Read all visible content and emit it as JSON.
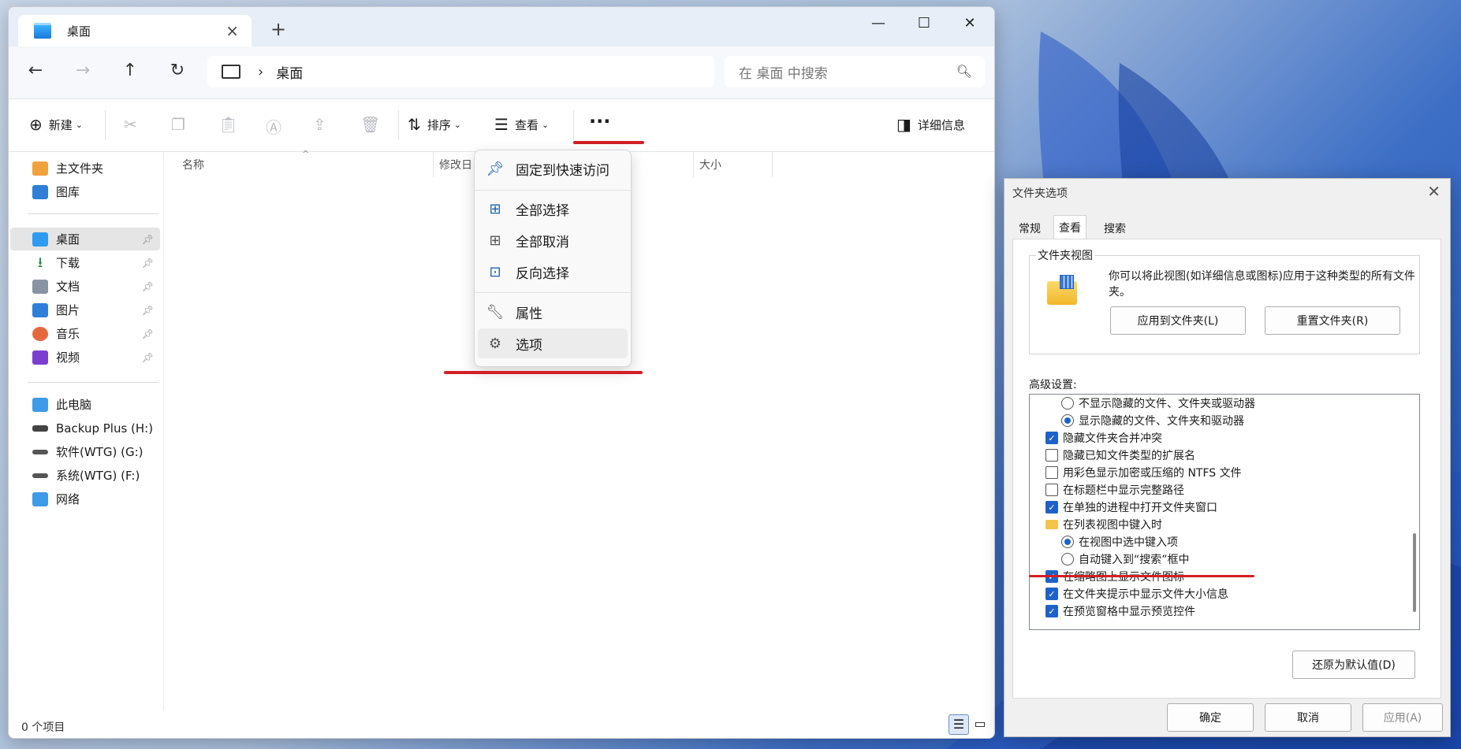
{
  "explorer": {
    "tab_title": "桌面",
    "address_path": "桌面",
    "search_placeholder": "在 桌面 中搜索",
    "toolbar": {
      "new_label": "新建",
      "sort_label": "排序",
      "view_label": "查看",
      "details_label": "详细信息"
    },
    "sidebar": {
      "top": [
        {
          "label": "主文件夹"
        },
        {
          "label": "图库"
        }
      ],
      "pinned": [
        {
          "label": "桌面",
          "selected": true
        },
        {
          "label": "下载"
        },
        {
          "label": "文档"
        },
        {
          "label": "图片"
        },
        {
          "label": "音乐"
        },
        {
          "label": "视频"
        }
      ],
      "drives": [
        {
          "label": "此电脑"
        },
        {
          "label": "Backup Plus (H:)"
        },
        {
          "label": "软件(WTG) (G:)"
        },
        {
          "label": "系统(WTG) (F:)"
        },
        {
          "label": "网络"
        }
      ]
    },
    "columns": {
      "name": "名称",
      "modified": "修改日",
      "size": "大小"
    },
    "status": "0 个项目"
  },
  "menu": {
    "items": [
      {
        "label": "固定到快速访问",
        "icon": "pin-icon"
      },
      {
        "label": "全部选择",
        "icon": "select-all-icon"
      },
      {
        "label": "全部取消",
        "icon": "select-none-icon"
      },
      {
        "label": "反向选择",
        "icon": "invert-selection-icon"
      },
      {
        "label": "属性",
        "icon": "wrench-icon"
      },
      {
        "label": "选项",
        "icon": "gear-icon"
      }
    ]
  },
  "dialog": {
    "title": "文件夹选项",
    "tabs": [
      "常规",
      "查看",
      "搜索"
    ],
    "active_tab": "查看",
    "folder_view": {
      "label": "文件夹视图",
      "description": "你可以将此视图(如详细信息或图标)应用于这种类型的所有文件夹。",
      "apply_button": "应用到文件夹(L)",
      "reset_button": "重置文件夹(R)"
    },
    "advanced_label": "高级设置:",
    "advanced_items": [
      {
        "type": "radio",
        "label": "不显示隐藏的文件、文件夹或驱动器",
        "checked": false,
        "indent": 1
      },
      {
        "type": "radio",
        "label": "显示隐藏的文件、文件夹和驱动器",
        "checked": true,
        "indent": 1
      },
      {
        "type": "check",
        "label": "隐藏文件夹合并冲突",
        "checked": true,
        "indent": 0
      },
      {
        "type": "check",
        "label": "隐藏已知文件类型的扩展名",
        "checked": false,
        "indent": 0
      },
      {
        "type": "check",
        "label": "用彩色显示加密或压缩的 NTFS 文件",
        "checked": false,
        "indent": 0
      },
      {
        "type": "check",
        "label": "在标题栏中显示完整路径",
        "checked": false,
        "indent": 0
      },
      {
        "type": "check",
        "label": "在单独的进程中打开文件夹窗口",
        "checked": true,
        "indent": 0
      },
      {
        "type": "folder",
        "label": "在列表视图中键入时",
        "checked": false,
        "indent": 0
      },
      {
        "type": "radio",
        "label": "在视图中选中键入项",
        "checked": true,
        "indent": 1
      },
      {
        "type": "radio",
        "label": "自动键入到“搜索”框中",
        "checked": false,
        "indent": 1
      },
      {
        "type": "check",
        "label": "在缩略图上显示文件图标",
        "checked": true,
        "indent": 0
      },
      {
        "type": "check",
        "label": "在文件夹提示中显示文件大小信息",
        "checked": true,
        "indent": 0
      },
      {
        "type": "check",
        "label": "在预览窗格中显示预览控件",
        "checked": true,
        "indent": 0
      }
    ],
    "restore_button": "还原为默认值(D)",
    "ok_button": "确定",
    "cancel_button": "取消",
    "apply_button": "应用(A)"
  }
}
